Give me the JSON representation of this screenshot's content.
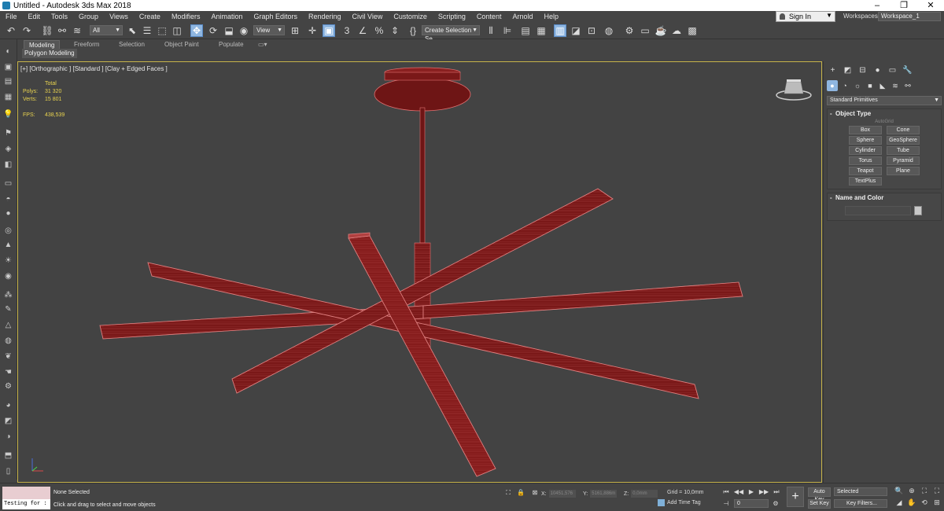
{
  "window": {
    "title": "Untitled - Autodesk 3ds Max 2018",
    "min": "–",
    "max": "❐",
    "close": "✕"
  },
  "menu": [
    "File",
    "Edit",
    "Tools",
    "Group",
    "Views",
    "Create",
    "Modifiers",
    "Animation",
    "Graph Editors",
    "Rendering",
    "Civil View",
    "Customize",
    "Scripting",
    "Content",
    "Arnold",
    "Help"
  ],
  "signin": {
    "label": "Sign In"
  },
  "workspace": {
    "label": "Workspaces:",
    "value": "Workspace_1"
  },
  "toolbar": {
    "filter": "All",
    "ref_coord": "View",
    "selection_set": "Create Selection Se"
  },
  "ribbon": {
    "tabs": [
      "Modeling",
      "Freeform",
      "Selection",
      "Object Paint",
      "Populate"
    ],
    "active": "Modeling",
    "sub_label": "Polygon Modeling"
  },
  "viewport": {
    "label": "[+] [Orthographic ] [Standard ] [Clay + Edged Faces ]",
    "stats": {
      "total": "Total",
      "polys_label": "Polys:",
      "polys": "31 320",
      "verts_label": "Verts:",
      "verts": "15 801",
      "fps_label": "FPS:",
      "fps": "438,539"
    },
    "border_color": "#c6b34a",
    "mesh_color": "#7a1818",
    "wire_color": "#e07070"
  },
  "command_panel": {
    "category": "Standard Primitives",
    "object_type": {
      "title": "Object Type",
      "autogrid": "AutoGrid",
      "buttons": [
        "Box",
        "Cone",
        "Sphere",
        "GeoSphere",
        "Cylinder",
        "Tube",
        "Torus",
        "Pyramid",
        "Teapot",
        "Plane",
        "TextPlus"
      ]
    },
    "name_color": {
      "title": "Name and Color"
    }
  },
  "status": {
    "maxscript_text": "Testing for :",
    "selection": "None Selected",
    "prompt": "Click and drag to select and move objects",
    "x_label": "X:",
    "x_value": "10451,576",
    "y_label": "Y:",
    "y_value": "5161,886m",
    "z_label": "Z:",
    "z_value": "0,0mm",
    "grid": "Grid = 10,0mm",
    "add_time_tag": "Add Time Tag",
    "frame": "0",
    "auto_key": "Auto Key",
    "set_key": "Set Key",
    "key_mode": "Selected",
    "key_filters": "Key Filters..."
  },
  "accent": "#8fb6e0"
}
